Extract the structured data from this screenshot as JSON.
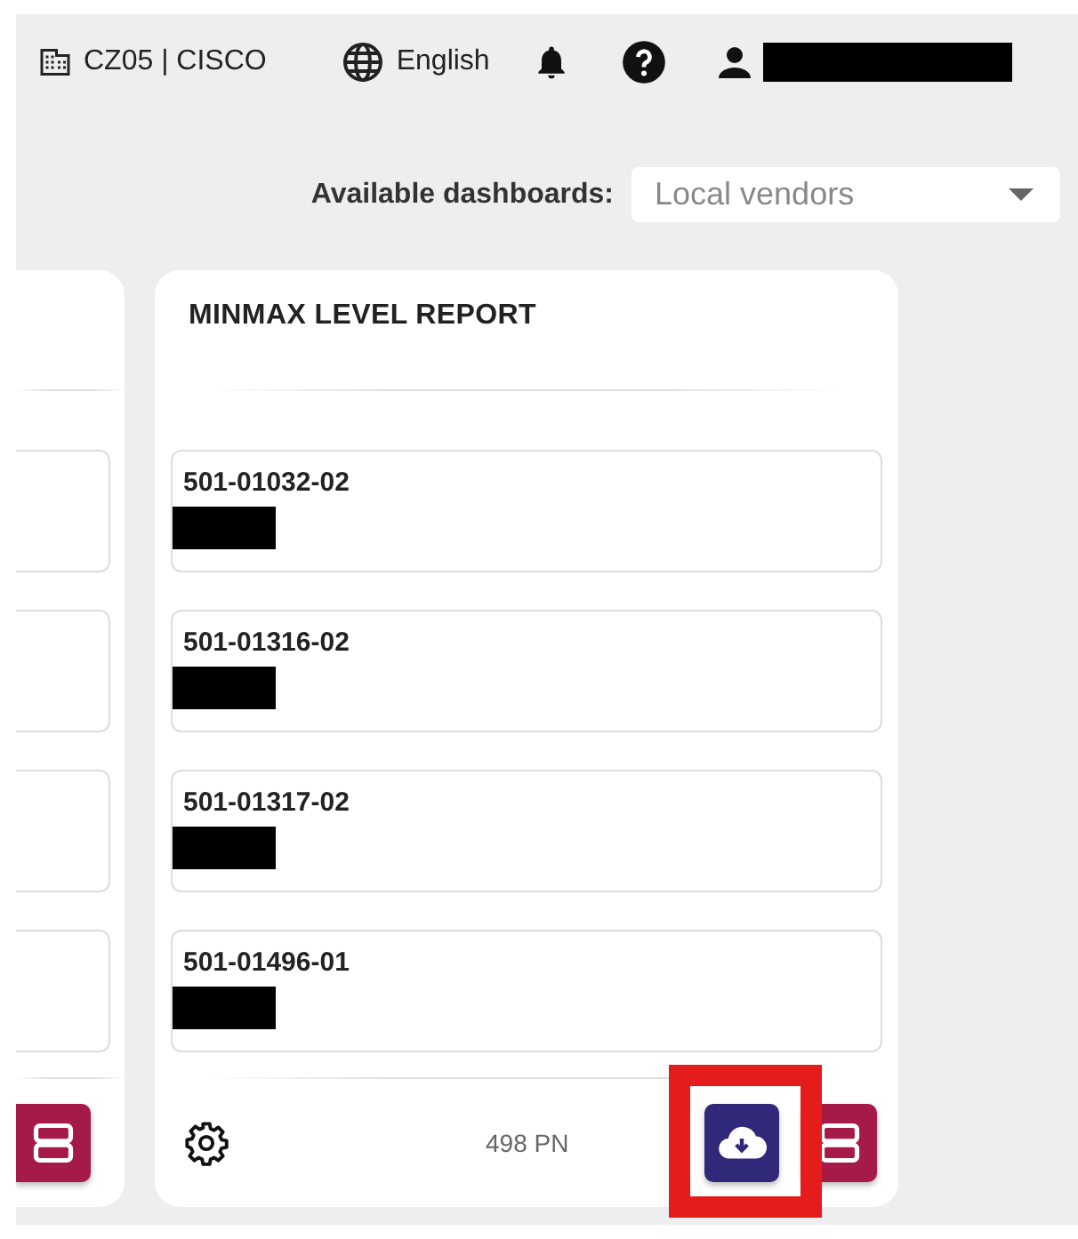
{
  "header": {
    "site": "CZ05 | CISCO",
    "language": "English",
    "user_redacted": true
  },
  "dashboard_picker": {
    "label": "Available dashboards:",
    "value": "Local vendors"
  },
  "card": {
    "title": "MINMAX LEVEL REPORT",
    "items": [
      {
        "part_number": "501-01032-02",
        "redacted": true
      },
      {
        "part_number": "501-01316-02",
        "redacted": true
      },
      {
        "part_number": "501-01317-02",
        "redacted": true
      },
      {
        "part_number": "501-01496-01",
        "redacted": true
      }
    ],
    "count": "498 PN",
    "download_highlighted": true
  }
}
